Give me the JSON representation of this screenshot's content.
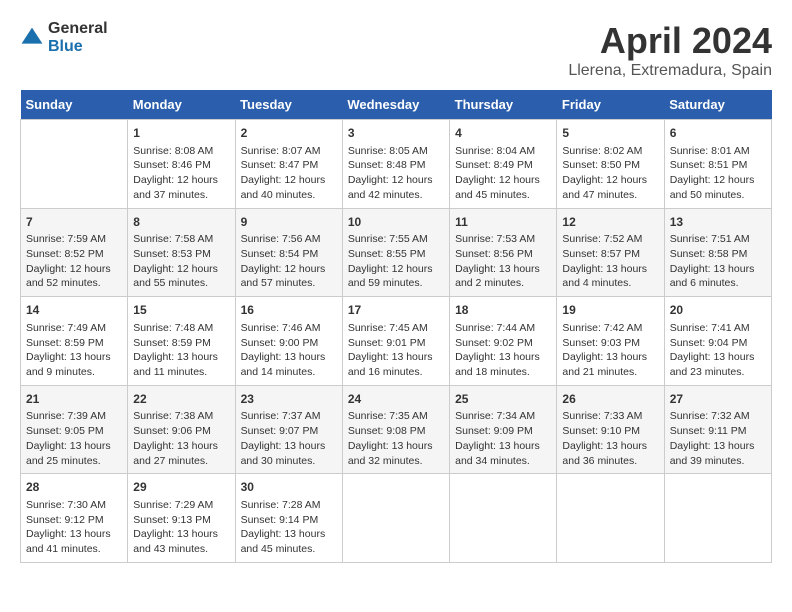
{
  "header": {
    "logo_line1": "General",
    "logo_line2": "Blue",
    "title": "April 2024",
    "subtitle": "Llerena, Extremadura, Spain"
  },
  "weekdays": [
    "Sunday",
    "Monday",
    "Tuesday",
    "Wednesday",
    "Thursday",
    "Friday",
    "Saturday"
  ],
  "weeks": [
    [
      {
        "day": "",
        "info": ""
      },
      {
        "day": "1",
        "info": "Sunrise: 8:08 AM\nSunset: 8:46 PM\nDaylight: 12 hours\nand 37 minutes."
      },
      {
        "day": "2",
        "info": "Sunrise: 8:07 AM\nSunset: 8:47 PM\nDaylight: 12 hours\nand 40 minutes."
      },
      {
        "day": "3",
        "info": "Sunrise: 8:05 AM\nSunset: 8:48 PM\nDaylight: 12 hours\nand 42 minutes."
      },
      {
        "day": "4",
        "info": "Sunrise: 8:04 AM\nSunset: 8:49 PM\nDaylight: 12 hours\nand 45 minutes."
      },
      {
        "day": "5",
        "info": "Sunrise: 8:02 AM\nSunset: 8:50 PM\nDaylight: 12 hours\nand 47 minutes."
      },
      {
        "day": "6",
        "info": "Sunrise: 8:01 AM\nSunset: 8:51 PM\nDaylight: 12 hours\nand 50 minutes."
      }
    ],
    [
      {
        "day": "7",
        "info": "Sunrise: 7:59 AM\nSunset: 8:52 PM\nDaylight: 12 hours\nand 52 minutes."
      },
      {
        "day": "8",
        "info": "Sunrise: 7:58 AM\nSunset: 8:53 PM\nDaylight: 12 hours\nand 55 minutes."
      },
      {
        "day": "9",
        "info": "Sunrise: 7:56 AM\nSunset: 8:54 PM\nDaylight: 12 hours\nand 57 minutes."
      },
      {
        "day": "10",
        "info": "Sunrise: 7:55 AM\nSunset: 8:55 PM\nDaylight: 12 hours\nand 59 minutes."
      },
      {
        "day": "11",
        "info": "Sunrise: 7:53 AM\nSunset: 8:56 PM\nDaylight: 13 hours\nand 2 minutes."
      },
      {
        "day": "12",
        "info": "Sunrise: 7:52 AM\nSunset: 8:57 PM\nDaylight: 13 hours\nand 4 minutes."
      },
      {
        "day": "13",
        "info": "Sunrise: 7:51 AM\nSunset: 8:58 PM\nDaylight: 13 hours\nand 6 minutes."
      }
    ],
    [
      {
        "day": "14",
        "info": "Sunrise: 7:49 AM\nSunset: 8:59 PM\nDaylight: 13 hours\nand 9 minutes."
      },
      {
        "day": "15",
        "info": "Sunrise: 7:48 AM\nSunset: 8:59 PM\nDaylight: 13 hours\nand 11 minutes."
      },
      {
        "day": "16",
        "info": "Sunrise: 7:46 AM\nSunset: 9:00 PM\nDaylight: 13 hours\nand 14 minutes."
      },
      {
        "day": "17",
        "info": "Sunrise: 7:45 AM\nSunset: 9:01 PM\nDaylight: 13 hours\nand 16 minutes."
      },
      {
        "day": "18",
        "info": "Sunrise: 7:44 AM\nSunset: 9:02 PM\nDaylight: 13 hours\nand 18 minutes."
      },
      {
        "day": "19",
        "info": "Sunrise: 7:42 AM\nSunset: 9:03 PM\nDaylight: 13 hours\nand 21 minutes."
      },
      {
        "day": "20",
        "info": "Sunrise: 7:41 AM\nSunset: 9:04 PM\nDaylight: 13 hours\nand 23 minutes."
      }
    ],
    [
      {
        "day": "21",
        "info": "Sunrise: 7:39 AM\nSunset: 9:05 PM\nDaylight: 13 hours\nand 25 minutes."
      },
      {
        "day": "22",
        "info": "Sunrise: 7:38 AM\nSunset: 9:06 PM\nDaylight: 13 hours\nand 27 minutes."
      },
      {
        "day": "23",
        "info": "Sunrise: 7:37 AM\nSunset: 9:07 PM\nDaylight: 13 hours\nand 30 minutes."
      },
      {
        "day": "24",
        "info": "Sunrise: 7:35 AM\nSunset: 9:08 PM\nDaylight: 13 hours\nand 32 minutes."
      },
      {
        "day": "25",
        "info": "Sunrise: 7:34 AM\nSunset: 9:09 PM\nDaylight: 13 hours\nand 34 minutes."
      },
      {
        "day": "26",
        "info": "Sunrise: 7:33 AM\nSunset: 9:10 PM\nDaylight: 13 hours\nand 36 minutes."
      },
      {
        "day": "27",
        "info": "Sunrise: 7:32 AM\nSunset: 9:11 PM\nDaylight: 13 hours\nand 39 minutes."
      }
    ],
    [
      {
        "day": "28",
        "info": "Sunrise: 7:30 AM\nSunset: 9:12 PM\nDaylight: 13 hours\nand 41 minutes."
      },
      {
        "day": "29",
        "info": "Sunrise: 7:29 AM\nSunset: 9:13 PM\nDaylight: 13 hours\nand 43 minutes."
      },
      {
        "day": "30",
        "info": "Sunrise: 7:28 AM\nSunset: 9:14 PM\nDaylight: 13 hours\nand 45 minutes."
      },
      {
        "day": "",
        "info": ""
      },
      {
        "day": "",
        "info": ""
      },
      {
        "day": "",
        "info": ""
      },
      {
        "day": "",
        "info": ""
      }
    ]
  ]
}
